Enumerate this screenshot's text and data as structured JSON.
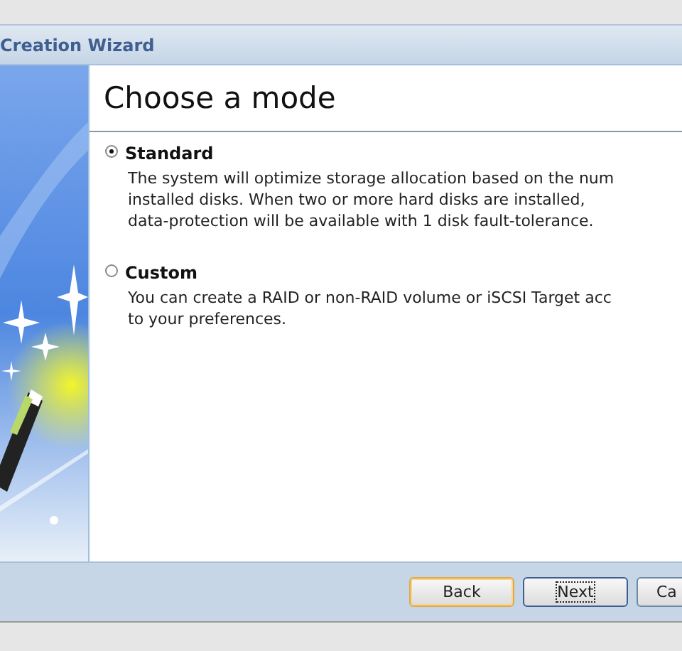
{
  "window": {
    "title": "Creation Wizard"
  },
  "heading": "Choose a mode",
  "options": [
    {
      "label": "Standard",
      "selected": true,
      "description_lines": [
        "The system will optimize storage allocation based on the num",
        "installed disks. When two or more hard disks are installed,",
        "data-protection will be available with 1 disk fault-tolerance."
      ]
    },
    {
      "label": "Custom",
      "selected": false,
      "description_lines": [
        "You can create a RAID or non-RAID volume or iSCSI Target acc",
        "to your preferences."
      ]
    }
  ],
  "buttons": [
    {
      "label": "Back",
      "kind": "hover"
    },
    {
      "label": "Next",
      "kind": "focused"
    },
    {
      "label": "Ca",
      "kind": "normal"
    }
  ]
}
